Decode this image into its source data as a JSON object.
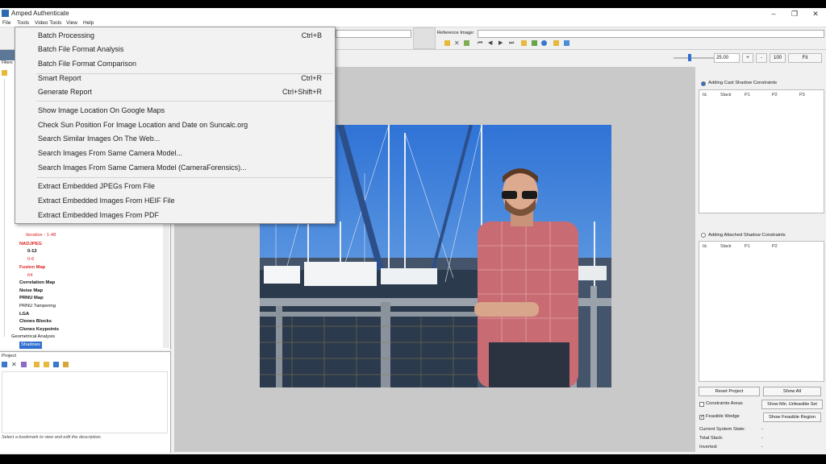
{
  "window": {
    "title": "Amped Authenticate"
  },
  "menubar": [
    "File",
    "Tools",
    "Video Tools",
    "View",
    "Help"
  ],
  "reference_label": "Reference Image:",
  "zoom": {
    "value": "25.00",
    "plus": "+",
    "minus": "-",
    "hundred": "100",
    "fit": "Fit"
  },
  "tools_menu": {
    "items": [
      {
        "label": "Batch Processing",
        "shortcut": "Ctrl+B"
      },
      {
        "label": "Batch File Format Analysis",
        "shortcut": ""
      },
      {
        "label": "Batch File Format Comparison",
        "shortcut": ""
      },
      {
        "label": "Smart Report",
        "shortcut": "Ctrl+R"
      },
      {
        "label": "Generate Report",
        "shortcut": "Ctrl+Shift+R"
      },
      {
        "label": "Show Image Location On Google Maps",
        "shortcut": ""
      },
      {
        "label": "Check Sun Position For Image Location and Date on Suncalc.org",
        "shortcut": ""
      },
      {
        "label": "Search Similar Images On The Web...",
        "shortcut": ""
      },
      {
        "label": "Search Images From Same Camera Model...",
        "shortcut": ""
      },
      {
        "label": "Search Images From Same Camera Model (CameraForensics)...",
        "shortcut": ""
      },
      {
        "label": "Extract Embedded JPEGs From File",
        "shortcut": ""
      },
      {
        "label": "Extract Embedded Images From HEIF File",
        "shortcut": ""
      },
      {
        "label": "Extract Embedded Images From PDF",
        "shortcut": ""
      }
    ]
  },
  "filters": {
    "tab": "Filters",
    "tree": [
      {
        "label": "Iterative - 1-48",
        "style": "red"
      },
      {
        "label": "NADJPEG",
        "style": "red bold"
      },
      {
        "label": "0-12",
        "style": "bold"
      },
      {
        "label": "0-6",
        "style": "red"
      },
      {
        "label": "Fusion Map",
        "style": "red bold"
      },
      {
        "label": "64",
        "style": "red"
      },
      {
        "label": "Correlation Map",
        "style": "bold"
      },
      {
        "label": "Noise Map",
        "style": "bold"
      },
      {
        "label": "PRNU Map",
        "style": "bold"
      },
      {
        "label": "PRNU Tampering",
        "style": ""
      },
      {
        "label": "LGA",
        "style": "bold"
      },
      {
        "label": "Clones Blocks",
        "style": "bold"
      },
      {
        "label": "Clones Keypoints",
        "style": "bold"
      },
      {
        "label": "Geometrical Analysis",
        "style": ""
      },
      {
        "label": "Shadows",
        "style": "selected"
      }
    ]
  },
  "project": {
    "title": "Project",
    "hint": "Select a bookmark to view and edit the description."
  },
  "shadow": {
    "cast_label": "Adding Cast Shadow Constraints",
    "cast_columns": [
      "Id.",
      "Slack",
      "P1",
      "P2",
      "P3"
    ],
    "attached_label": "Adding Attached Shadow Constraints",
    "attached_columns": [
      "Id.",
      "Slack",
      "P1",
      "P2"
    ],
    "reset_project": "Reset Project",
    "show_all": "Show All",
    "constraints_areas": "Constraints Areas",
    "show_min_unfeasible": "Show Min. Unfeasible Set",
    "feasible_wedge": "Feasible Wedge",
    "show_feasible_region": "Show Feasible Region",
    "current_state_label": "Current System State:",
    "total_slack_label": "Total Slack:",
    "inverted_label": "Inverted:",
    "current_state_value": "-",
    "total_slack_value": "-",
    "inverted_value": "-"
  },
  "colors": {
    "accent": "#2b6cb0",
    "sky": "#3d7fd8",
    "shirt": "#c96b72"
  }
}
